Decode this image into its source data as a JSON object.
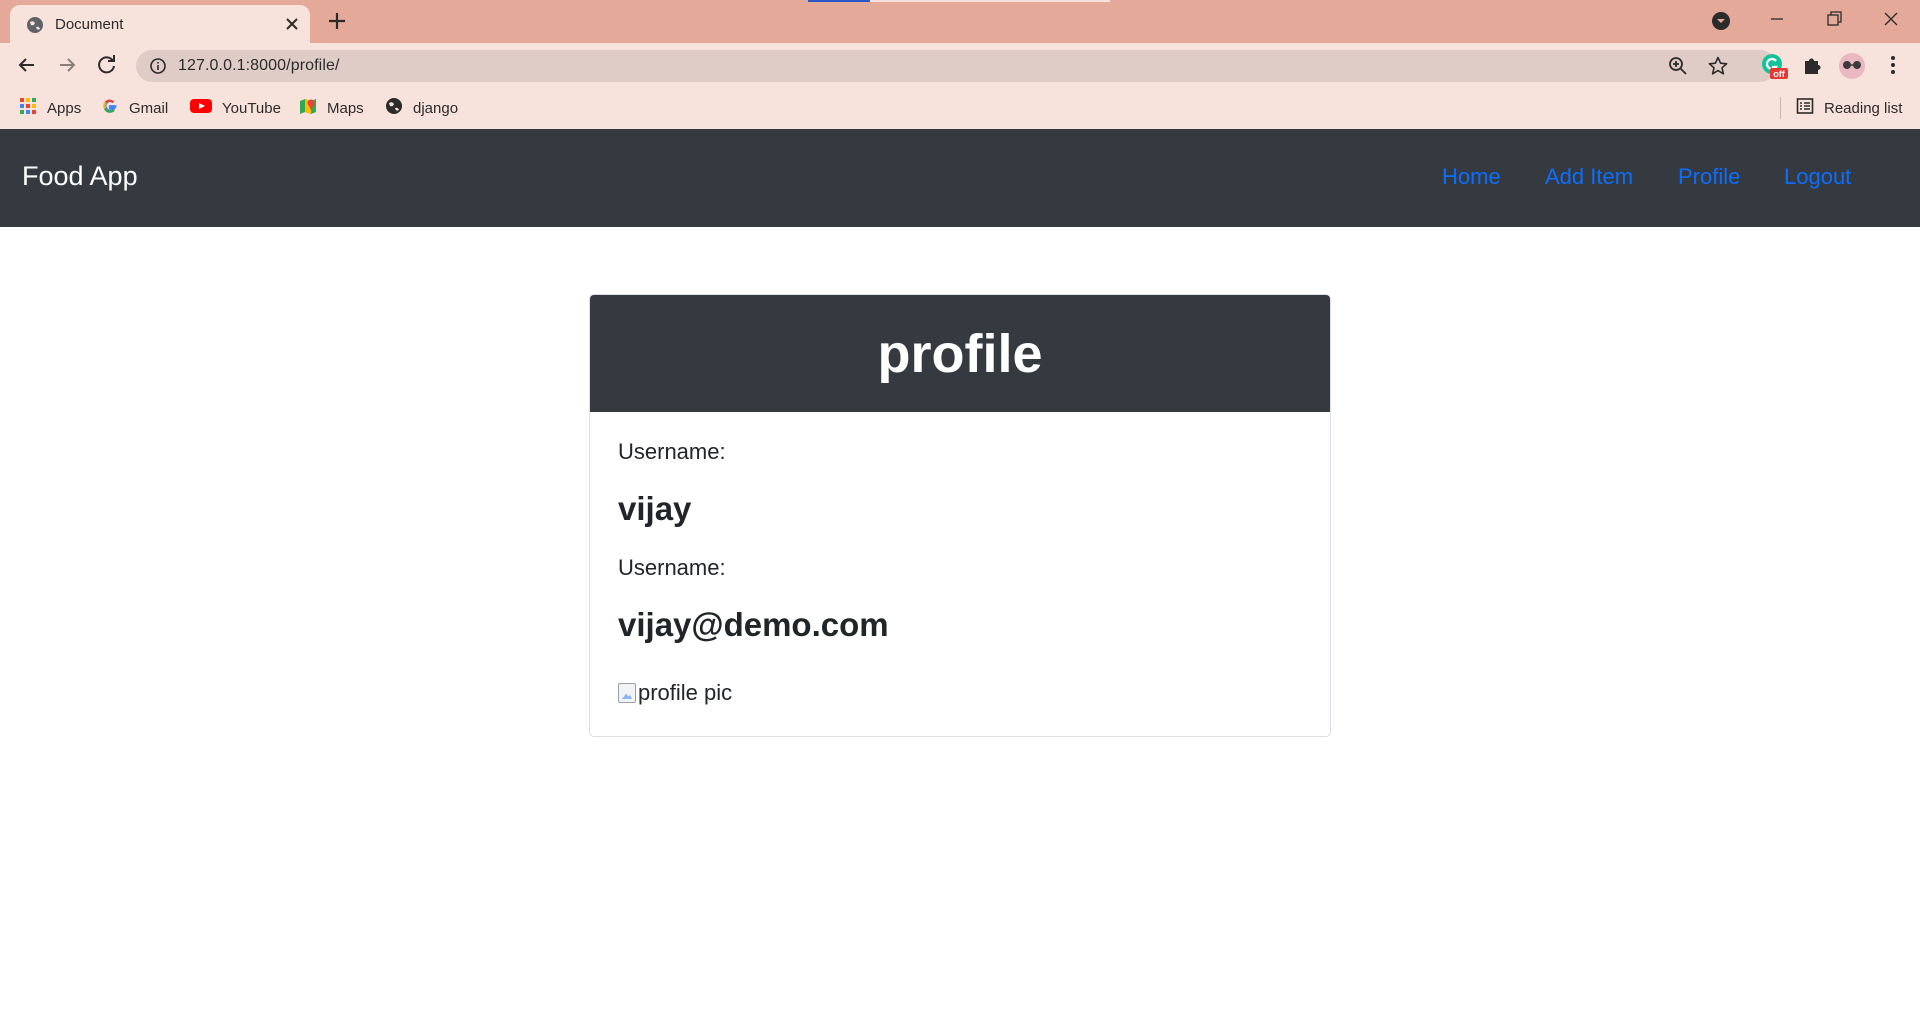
{
  "browser": {
    "tab_title": "Document",
    "url": "127.0.0.1:8000/profile/",
    "bookmarks": [
      {
        "label": "Apps",
        "icon": "apps-grid-icon"
      },
      {
        "label": "Gmail",
        "icon": "google-icon"
      },
      {
        "label": "YouTube",
        "icon": "youtube-icon"
      },
      {
        "label": "Maps",
        "icon": "maps-icon"
      },
      {
        "label": "django",
        "icon": "globe-icon"
      }
    ],
    "reading_list": "Reading list",
    "extension_badge": "off"
  },
  "navbar": {
    "brand": "Food App",
    "links": [
      "Home",
      "Add Item",
      "Profile",
      "Logout"
    ],
    "background": "#343a40",
    "link_color": "#0d6efd"
  },
  "profile": {
    "title": "profile",
    "username_label": "Username:",
    "username_value": "vijay",
    "email_label": "Username:",
    "email_value": "vijay@demo.com",
    "pic_alt": "profile pic"
  }
}
